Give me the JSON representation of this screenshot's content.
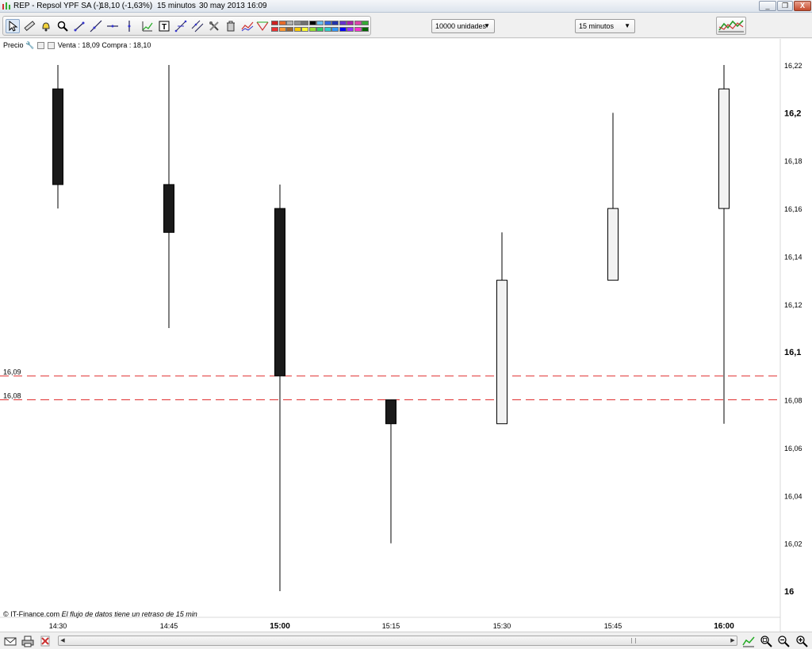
{
  "window": {
    "title_symbol": "REP - Repsol YPF SA (-)",
    "title_quote": "18,10 (-1,63%)",
    "title_interval": "15 minutos",
    "title_datetime": "30 may 2013 16:09",
    "minimize": "_",
    "restore": "❐",
    "close": "X"
  },
  "toolbar": {
    "units_select": "10000 unidades",
    "interval_select": "15 minutos",
    "tools": [
      "pointer-icon",
      "ruler-icon",
      "alarm-icon",
      "zoom-icon",
      "trendline-icon",
      "line-icon",
      "horizontal-line-icon",
      "vertical-line-icon",
      "regression-icon",
      "text-icon",
      "fibonacci-icon",
      "channel-icon",
      "settings-icon",
      "trash-icon",
      "indicator-icon",
      "pattern-icon"
    ],
    "palette_row1": [
      "#cc2222",
      "#e56a2a",
      "#b0b0b0",
      "#909090",
      "#707070",
      "#000000",
      "#66bbee",
      "#3366dd",
      "#2233aa",
      "#6633cc",
      "#aa22aa",
      "#dd44aa",
      "#33aa33"
    ],
    "palette_row2": [
      "#ee3333",
      "#ff9933",
      "#996633",
      "#ffcc00",
      "#ffff33",
      "#99dd33",
      "#33cc66",
      "#33cccc",
      "#3399ff",
      "#0000ff",
      "#9933ff",
      "#ff33cc",
      "#006600"
    ]
  },
  "chart_header": {
    "label": "Precio",
    "bid_ask": "Venta : 18,09 Compra : 18,10"
  },
  "footer": {
    "copyright": "© IT-Finance.com",
    "delay_notice": "El flujo de datos tiene un retraso de 15 min"
  },
  "colors": {
    "bearish_candle": "#1a1a1a",
    "bullish_candle": "#f2f2f2",
    "level_line": "#e03030"
  },
  "chart_data": {
    "type": "candlestick",
    "categories": [
      "14:30",
      "14:45",
      "15:00",
      "15:15",
      "15:30",
      "15:45",
      "16:00"
    ],
    "bold_categories": [
      "15:00",
      "16:00"
    ],
    "ohlc": [
      {
        "time": "14:30",
        "open": 16.21,
        "high": 16.22,
        "low": 16.16,
        "close": 16.17
      },
      {
        "time": "14:45",
        "open": 16.17,
        "high": 16.22,
        "low": 16.11,
        "close": 16.15
      },
      {
        "time": "15:00",
        "open": 16.16,
        "high": 16.17,
        "low": 16.0,
        "close": 16.09
      },
      {
        "time": "15:15",
        "open": 16.08,
        "high": 16.08,
        "low": 16.02,
        "close": 16.07
      },
      {
        "time": "15:30",
        "open": 16.07,
        "high": 16.15,
        "low": 16.07,
        "close": 16.13
      },
      {
        "time": "15:45",
        "open": 16.13,
        "high": 16.2,
        "low": 16.13,
        "close": 16.16
      },
      {
        "time": "16:00",
        "open": 16.16,
        "high": 16.22,
        "low": 16.07,
        "close": 16.21
      }
    ],
    "y_ticks": [
      "16,22",
      "16,2",
      "16,18",
      "16,16",
      "16,14",
      "16,12",
      "16,1",
      "16,08",
      "16,06",
      "16,04",
      "16,02",
      "16"
    ],
    "y_tick_values": [
      16.22,
      16.2,
      16.18,
      16.16,
      16.14,
      16.12,
      16.1,
      16.08,
      16.06,
      16.04,
      16.02,
      16.0
    ],
    "bold_y_ticks": [
      "16,2",
      "16,1",
      "16"
    ],
    "ylim": [
      16.0,
      16.22
    ],
    "horizontal_levels": [
      {
        "label": "16,09",
        "value": 16.09
      },
      {
        "label": "16,08",
        "value": 16.08
      }
    ],
    "grid": false
  }
}
